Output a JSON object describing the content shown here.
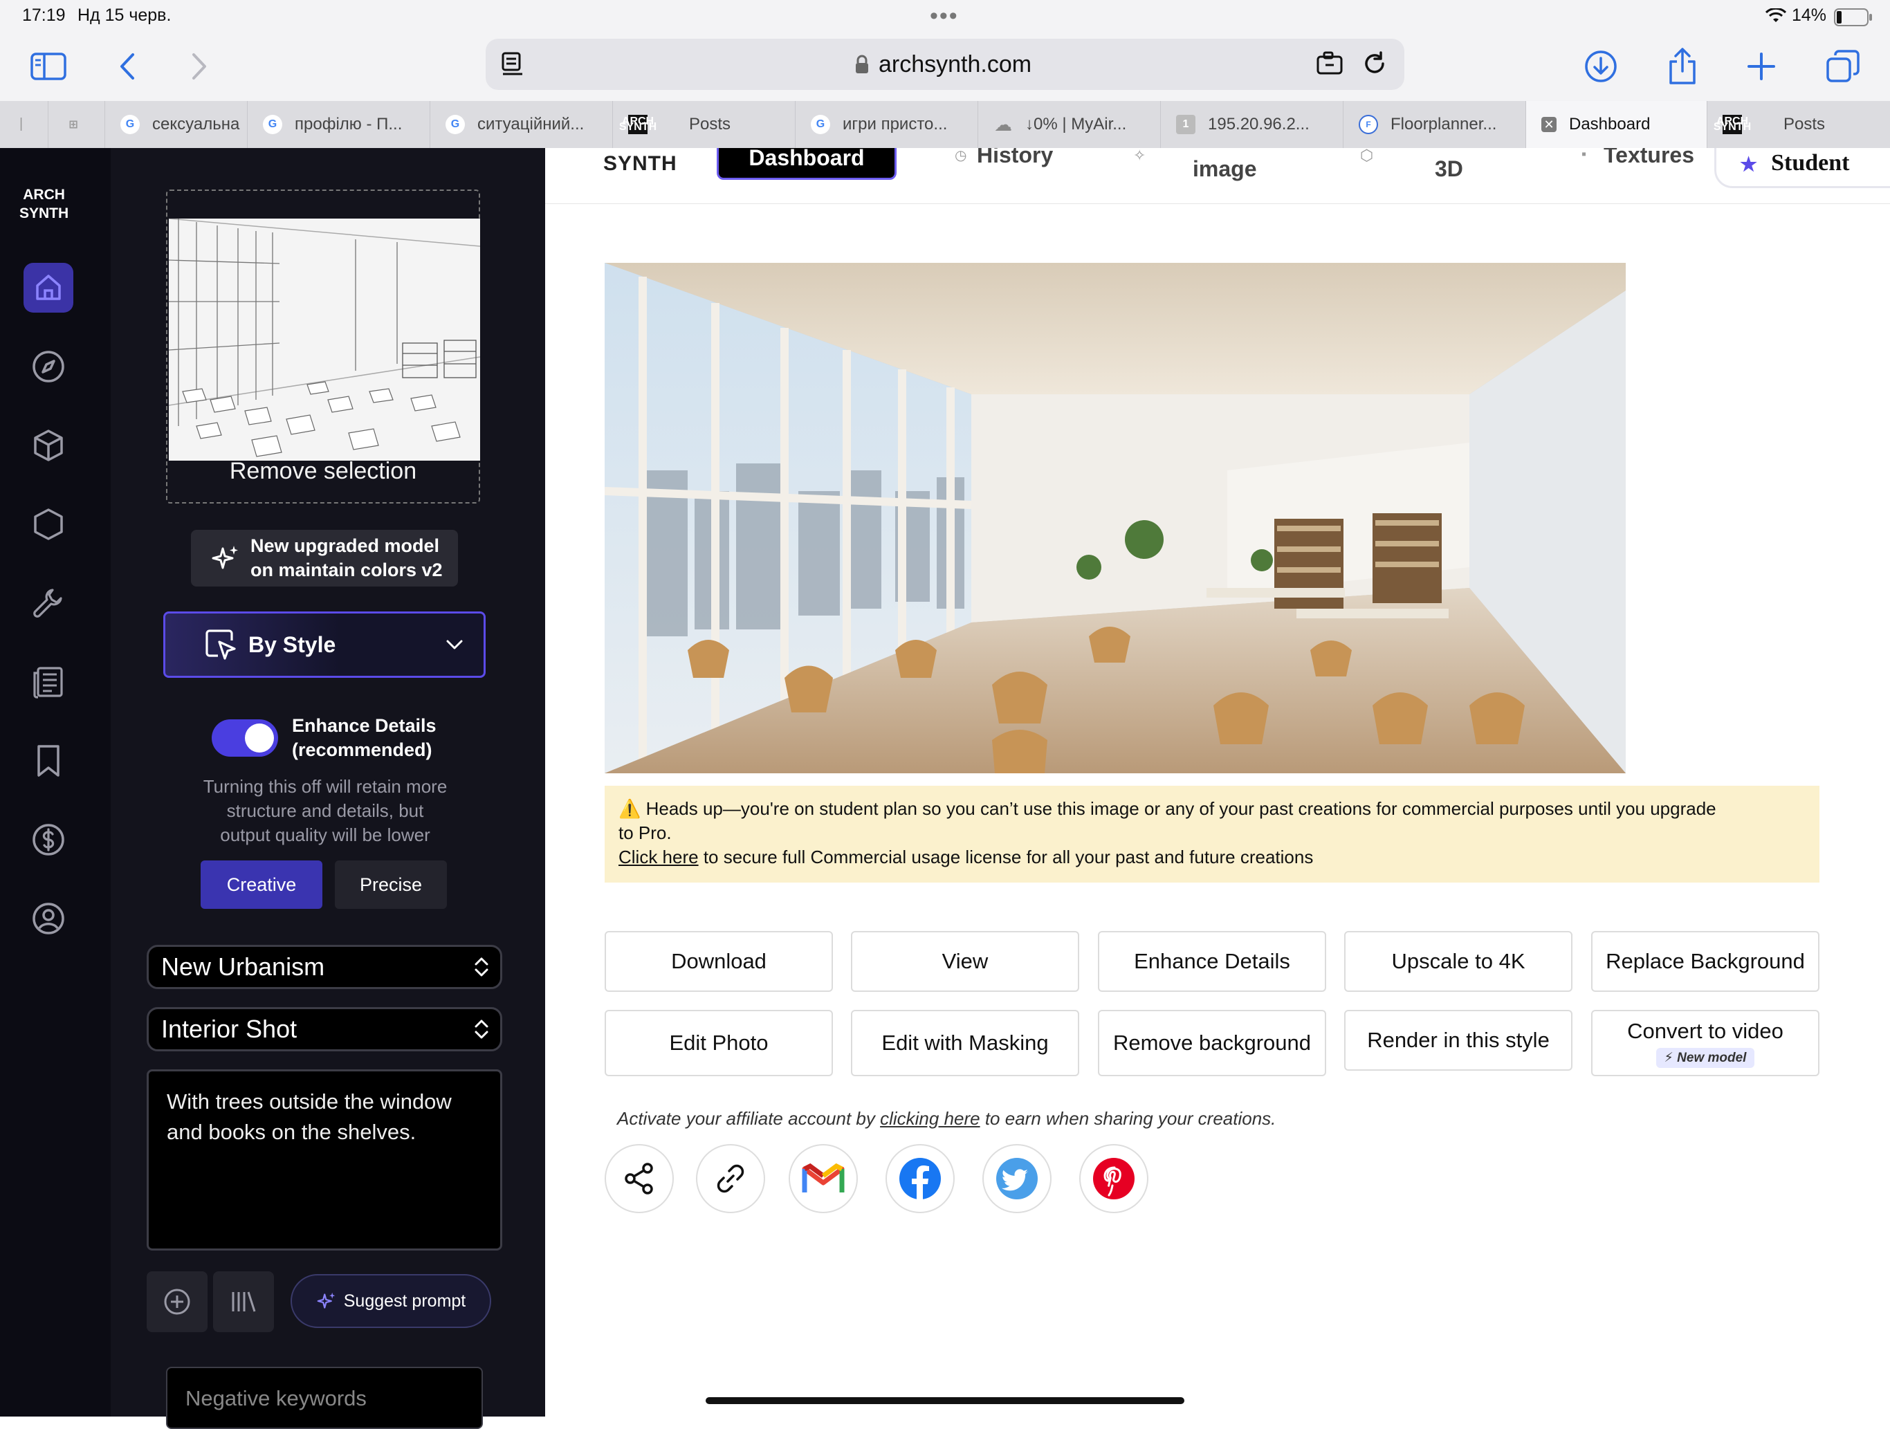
{
  "status_bar": {
    "time": "17:19",
    "date": "Нд 15 черв.",
    "battery": "14%"
  },
  "browser": {
    "url": "archsynth.com",
    "tabs": [
      {
        "title": "",
        "icon": "sidebar-tab-icon"
      },
      {
        "title": "",
        "icon": "grid-icon"
      },
      {
        "title": "сексуальна",
        "icon": "google-icon"
      },
      {
        "title": "профілю - П...",
        "icon": "google-icon"
      },
      {
        "title": "ситуаційний...",
        "icon": "google-icon"
      },
      {
        "title": "Posts",
        "icon": "archsynth-icon"
      },
      {
        "title": "игри присто...",
        "icon": "google-icon"
      },
      {
        "title": "↓0% | MyAir...",
        "icon": "cloud-icon"
      },
      {
        "title": "195.20.96.2...",
        "icon": "number-icon",
        "badge": "1"
      },
      {
        "title": "Floorplanner...",
        "icon": "floorplanner-icon"
      },
      {
        "title": "Dashboard",
        "icon": "close-icon",
        "active": true
      },
      {
        "title": "Posts",
        "icon": "archsynth-icon"
      }
    ]
  },
  "logo": {
    "line1": "ARCH",
    "line2": "SYNTH"
  },
  "rail": [
    "home-icon",
    "compass-icon",
    "cube-icon",
    "hexagon-icon",
    "wrench-icon",
    "document-icon",
    "bookmark-icon",
    "dollar-icon",
    "user-circle-icon"
  ],
  "panel": {
    "remove_selection": "Remove selection",
    "model_line1": "New upgraded model",
    "model_line2": "on maintain colors v2",
    "style_select": "By Style",
    "enhance_line1": "Enhance Details",
    "enhance_line2": "(recommended)",
    "enhance_on": true,
    "hint_line1": "Turning this off will retain more",
    "hint_line2": "structure and details, but",
    "hint_line3": "output quality will be lower",
    "creative": "Creative",
    "precise": "Precise",
    "style_value": "New Urbanism",
    "shot_value": "Interior Shot",
    "prompt_text": "With trees outside the window and books on the shelves.",
    "suggest": "Suggest prompt",
    "negative_placeholder": "Negative keywords"
  },
  "nav": {
    "logo": "SYNTH",
    "dashboard": "Dashboard",
    "history": "History",
    "image": "image",
    "threed": "3D",
    "textures": "Textures",
    "student": "Student"
  },
  "notice": {
    "line1": "⚠️ Heads up—you're on student plan so you can’t use this image or any of your past creations for commercial purposes until you upgrade",
    "line2": "to Pro.",
    "link": "Click here",
    "line3": " to secure full Commercial usage license for all your past and future creations"
  },
  "actions": {
    "download": "Download",
    "view": "View",
    "enhance": "Enhance Details",
    "upscale": "Upscale to 4K",
    "replace_bg": "Replace Background",
    "edit_photo": "Edit Photo",
    "edit_masking": "Edit with Masking",
    "remove_bg": "Remove background",
    "render_style": "Render in this style",
    "convert_video": "Convert to video",
    "new_model": "⚡ New model"
  },
  "affiliate": {
    "prefix": "Activate your affiliate account by ",
    "link": "clicking here",
    "suffix": " to earn when sharing your creations."
  },
  "share_icons": [
    "share-icon",
    "link-icon",
    "gmail-icon",
    "facebook-icon",
    "twitter-icon",
    "pinterest-icon"
  ],
  "colors": {
    "accent": "#5b4be8",
    "panel_bg": "#13131c",
    "notice_bg": "#fbf1cd"
  }
}
